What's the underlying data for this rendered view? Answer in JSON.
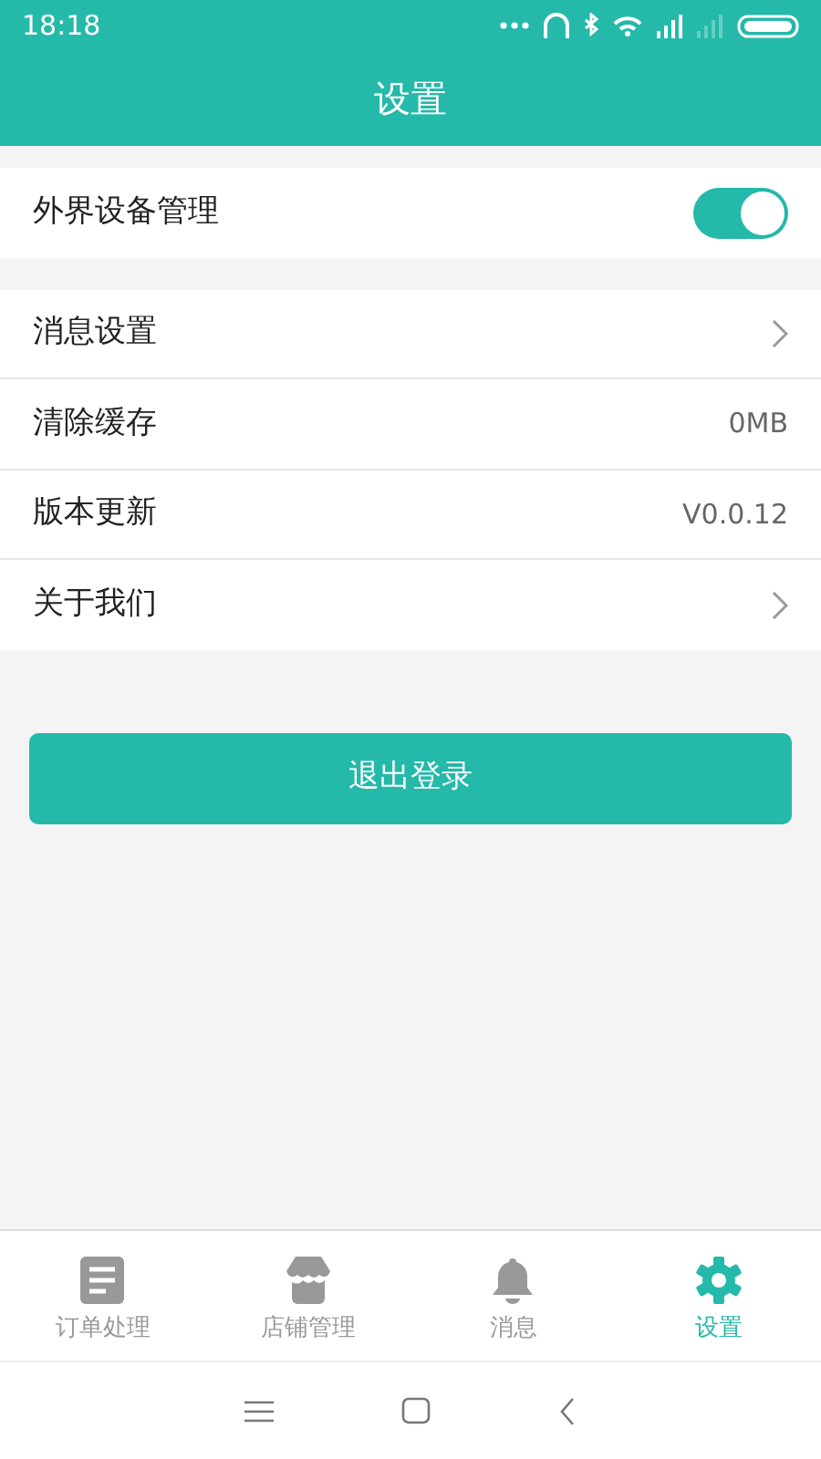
{
  "status_bar": {
    "time": "18:18"
  },
  "header": {
    "title": "设置"
  },
  "groups": [
    [
      {
        "kind": "toggle",
        "label": "外界设备管理",
        "on": true
      }
    ],
    [
      {
        "kind": "link",
        "label": "消息设置"
      },
      {
        "kind": "value",
        "label": "清除缓存",
        "value": "0MB"
      },
      {
        "kind": "value",
        "label": "版本更新",
        "value": "V0.0.12"
      },
      {
        "kind": "link",
        "label": "关于我们"
      }
    ]
  ],
  "logout_button": "退出登录",
  "tabs": [
    {
      "label": "订单处理",
      "kind": "doc",
      "selected": false
    },
    {
      "label": "店铺管理",
      "kind": "store",
      "selected": false
    },
    {
      "label": "消息",
      "kind": "bell",
      "selected": false
    },
    {
      "label": "设置",
      "kind": "gear",
      "selected": true
    }
  ]
}
